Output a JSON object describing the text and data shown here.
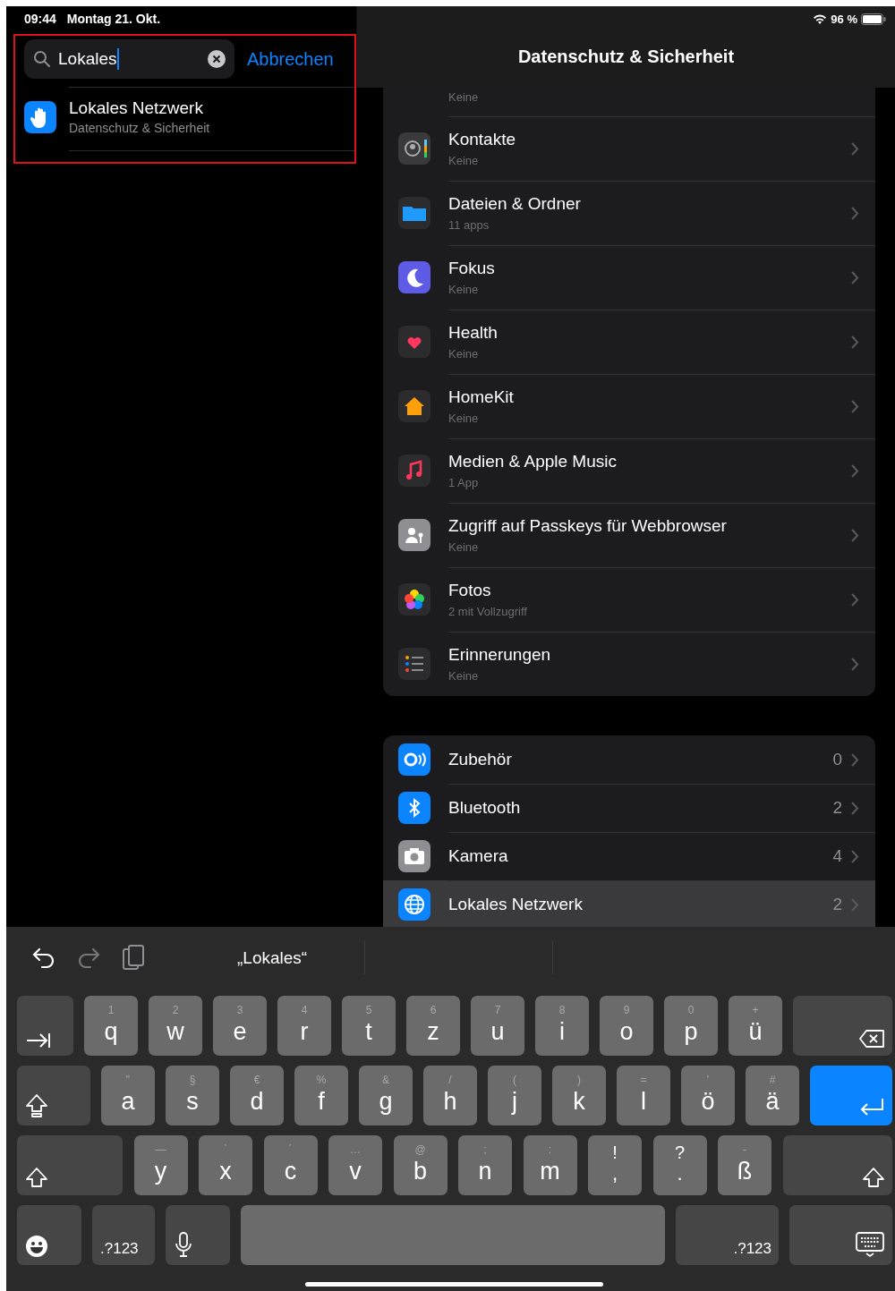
{
  "status_bar": {
    "time": "09:44",
    "date": "Montag 21. Okt.",
    "battery": "96 %"
  },
  "search": {
    "value": "Lokales",
    "cancel": "Abbrechen"
  },
  "results": [
    {
      "title": "Lokales Netzwerk",
      "subtitle": "Datenschutz & Sicherheit"
    }
  ],
  "detail": {
    "title": "Datenschutz & Sicherheit",
    "apps": [
      {
        "kind": "partial",
        "subtitle": "Keine"
      },
      {
        "kind": "full",
        "title": "Kontakte",
        "subtitle": "Keine"
      },
      {
        "kind": "full",
        "title": "Dateien & Ordner",
        "subtitle": "11 apps"
      },
      {
        "kind": "full",
        "title": "Fokus",
        "subtitle": "Keine"
      },
      {
        "kind": "full",
        "title": "Health",
        "subtitle": "Keine"
      },
      {
        "kind": "full",
        "title": "HomeKit",
        "subtitle": "Keine"
      },
      {
        "kind": "full",
        "title": "Medien & Apple Music",
        "subtitle": "1 App"
      },
      {
        "kind": "full",
        "title": "Zugriff auf Passkeys für Webbrowser",
        "subtitle": "Keine"
      },
      {
        "kind": "full",
        "title": "Fotos",
        "subtitle": "2 mit Vollzugriff"
      },
      {
        "kind": "full",
        "title": "Erinnerungen",
        "subtitle": "Keine"
      }
    ],
    "devices": [
      {
        "title": "Zubehör",
        "count": "0",
        "selected": false
      },
      {
        "title": "Bluetooth",
        "count": "2",
        "selected": false
      },
      {
        "title": "Kamera",
        "count": "4",
        "selected": false
      },
      {
        "title": "Lokales Netzwerk",
        "count": "2",
        "selected": true
      }
    ]
  },
  "keyboard": {
    "suggestion": "„Lokales“",
    "rows": [
      [
        {
          "kind": "tab"
        },
        {
          "kind": "letter",
          "label": "q",
          "hint": "1"
        },
        {
          "kind": "letter",
          "label": "w",
          "hint": "2"
        },
        {
          "kind": "letter",
          "label": "e",
          "hint": "3"
        },
        {
          "kind": "letter",
          "label": "r",
          "hint": "4"
        },
        {
          "kind": "letter",
          "label": "t",
          "hint": "5"
        },
        {
          "kind": "letter",
          "label": "z",
          "hint": "6"
        },
        {
          "kind": "letter",
          "label": "u",
          "hint": "7"
        },
        {
          "kind": "letter",
          "label": "i",
          "hint": "8"
        },
        {
          "kind": "letter",
          "label": "o",
          "hint": "9"
        },
        {
          "kind": "letter",
          "label": "p",
          "hint": "0"
        },
        {
          "kind": "letter",
          "label": "ü",
          "hint": "+"
        },
        {
          "kind": "backspace"
        }
      ],
      [
        {
          "kind": "caps"
        },
        {
          "kind": "letter",
          "label": "a",
          "hint": "\""
        },
        {
          "kind": "letter",
          "label": "s",
          "hint": "§"
        },
        {
          "kind": "letter",
          "label": "d",
          "hint": "€"
        },
        {
          "kind": "letter",
          "label": "f",
          "hint": "%"
        },
        {
          "kind": "letter",
          "label": "g",
          "hint": "&"
        },
        {
          "kind": "letter",
          "label": "h",
          "hint": "/"
        },
        {
          "kind": "letter",
          "label": "j",
          "hint": "("
        },
        {
          "kind": "letter",
          "label": "k",
          "hint": ")"
        },
        {
          "kind": "letter",
          "label": "l",
          "hint": "="
        },
        {
          "kind": "letter",
          "label": "ö",
          "hint": "'"
        },
        {
          "kind": "letter",
          "label": "ä",
          "hint": "#"
        },
        {
          "kind": "return"
        }
      ],
      [
        {
          "kind": "shift"
        },
        {
          "kind": "letter",
          "label": "y",
          "hint": "—"
        },
        {
          "kind": "letter",
          "label": "x",
          "hint": "`"
        },
        {
          "kind": "letter",
          "label": "c",
          "hint": "´"
        },
        {
          "kind": "letter",
          "label": "v",
          "hint": "…"
        },
        {
          "kind": "letter",
          "label": "b",
          "hint": "@"
        },
        {
          "kind": "letter",
          "label": "n",
          "hint": ";"
        },
        {
          "kind": "letter",
          "label": "m",
          "hint": ":"
        },
        {
          "kind": "punct",
          "label": ",",
          "hint": "!"
        },
        {
          "kind": "punct",
          "label": ".",
          "hint": "?"
        },
        {
          "kind": "letter",
          "label": "ß",
          "hint": "-"
        },
        {
          "kind": "shift2"
        }
      ],
      [
        {
          "kind": "emoji"
        },
        {
          "kind": "numbers",
          "label": ".?123"
        },
        {
          "kind": "mic"
        },
        {
          "kind": "space"
        },
        {
          "kind": "numbers2",
          "label": ".?123"
        },
        {
          "kind": "dismiss"
        }
      ]
    ]
  }
}
